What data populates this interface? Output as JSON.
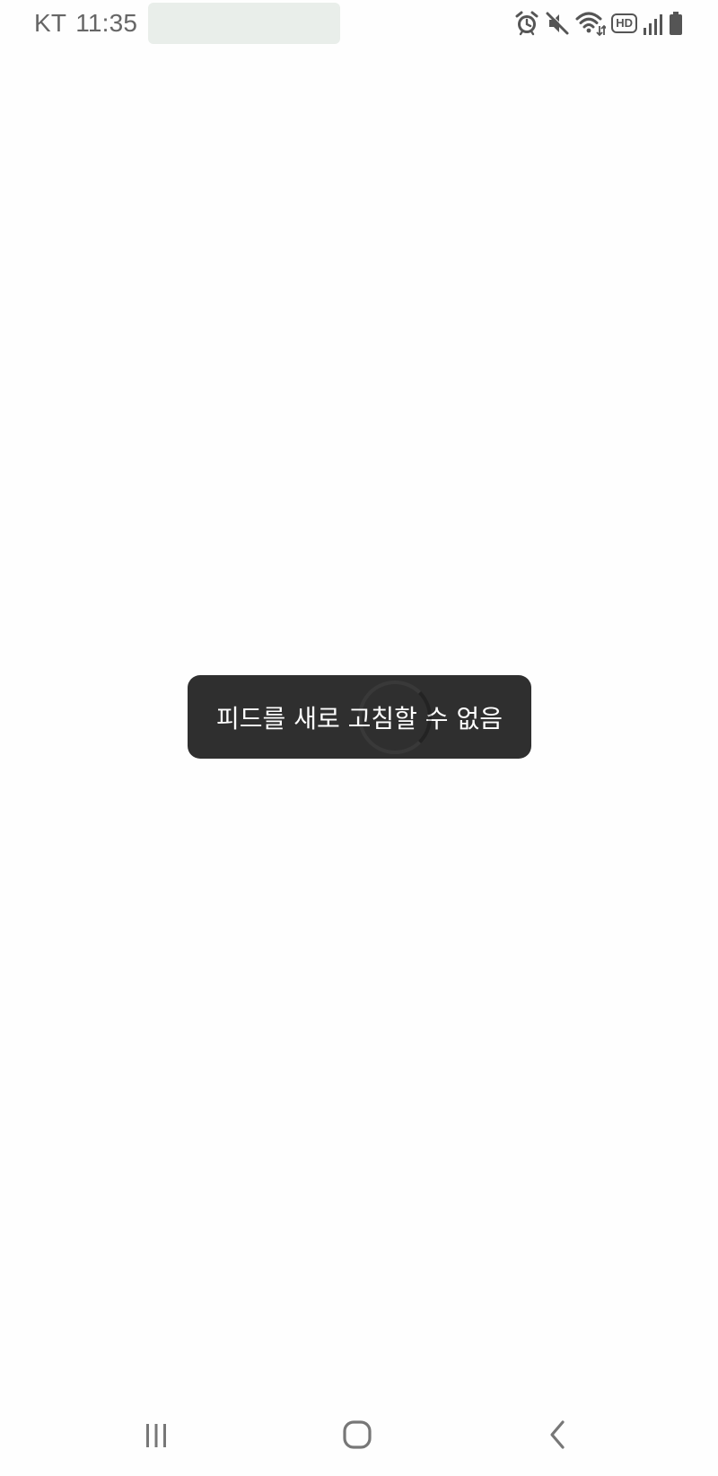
{
  "status_bar": {
    "carrier": "KT",
    "time": "11:35",
    "redacted_color": "#e9eeea",
    "icons": [
      "alarm-icon",
      "mute-icon",
      "wifi-icon",
      "hd-voice-icon",
      "signal-icon",
      "battery-icon"
    ],
    "hd_label": "HD"
  },
  "toast": {
    "message": "피드를 새로 고침할 수 없음",
    "background": "#2f2f2f"
  },
  "nav_bar": {
    "icons": [
      "recent-apps-icon",
      "home-icon",
      "back-icon"
    ]
  }
}
